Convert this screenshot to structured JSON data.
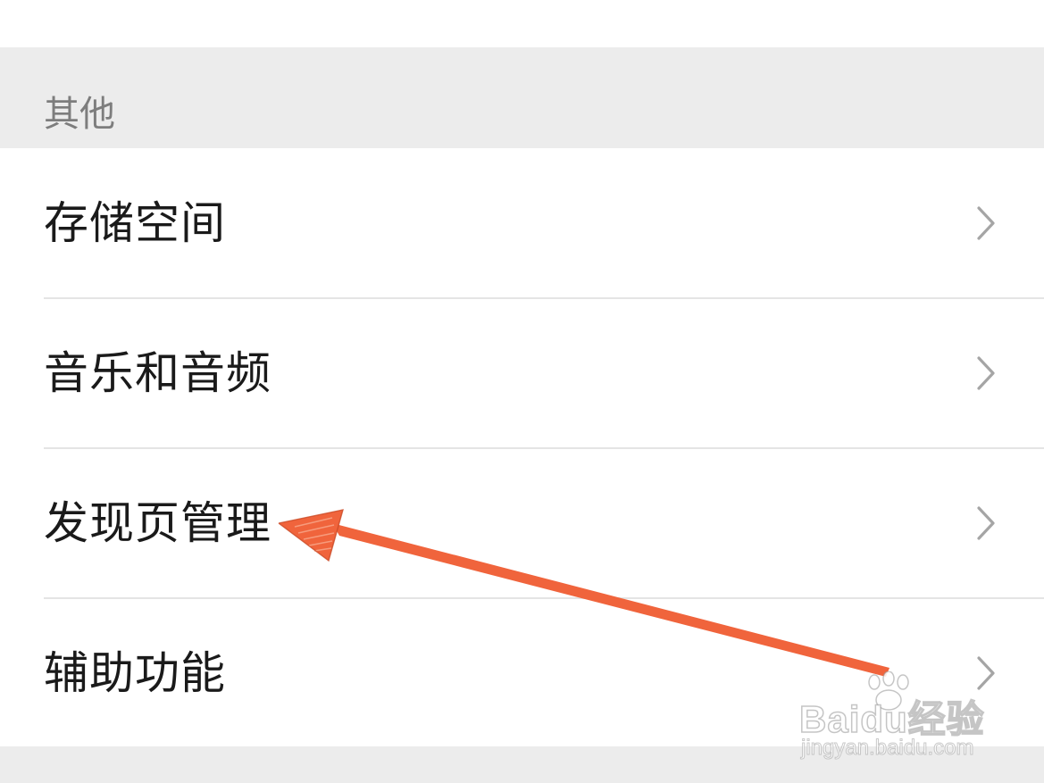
{
  "section": {
    "header_label": "其他"
  },
  "settings_list": {
    "items": [
      {
        "label": "存储空间",
        "icon": "chevron-right-icon"
      },
      {
        "label": "音乐和音频",
        "icon": "chevron-right-icon"
      },
      {
        "label": "发现页管理",
        "icon": "chevron-right-icon"
      },
      {
        "label": "辅助功能",
        "icon": "chevron-right-icon"
      }
    ]
  },
  "annotation": {
    "arrow_color": "#f0643c",
    "points_to": "发现页管理"
  },
  "watermark": {
    "logo_text": "Baidu经验",
    "url": "jingyan.baidu.com"
  },
  "colors": {
    "section_background": "#ececec",
    "row_background": "#ffffff",
    "label_text": "#1a1a1a",
    "header_text": "#7d7d7d",
    "chevron": "#a5a5a5",
    "divider": "#e4e4e4"
  }
}
